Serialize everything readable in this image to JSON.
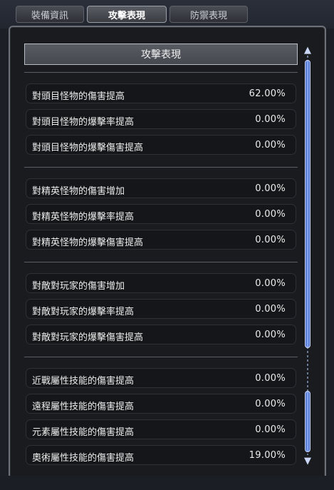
{
  "tabs": [
    {
      "label": "裝備資訊",
      "active": false
    },
    {
      "label": "攻擊表現",
      "active": true
    },
    {
      "label": "防禦表現",
      "active": false
    }
  ],
  "panel": {
    "header": "攻擊表現",
    "groups": [
      [
        {
          "label": "對頭目怪物的傷害提高",
          "value": "62.00%"
        },
        {
          "label": "對頭目怪物的爆擊率提高",
          "value": "0.00%"
        },
        {
          "label": "對頭目怪物的爆擊傷害提高",
          "value": "0.00%"
        }
      ],
      [
        {
          "label": "對精英怪物的傷害增加",
          "value": "0.00%"
        },
        {
          "label": "對精英怪物的爆擊率提高",
          "value": "0.00%"
        },
        {
          "label": "對精英怪物的爆擊傷害提高",
          "value": "0.00%"
        }
      ],
      [
        {
          "label": "對敵對玩家的傷害增加",
          "value": "0.00%"
        },
        {
          "label": "對敵對玩家的爆擊率提高",
          "value": "0.00%"
        },
        {
          "label": "對敵對玩家的爆擊傷害提高",
          "value": "0.00%"
        }
      ],
      [
        {
          "label": "近戰屬性技能的傷害提高",
          "value": "0.00%"
        },
        {
          "label": "遠程屬性技能的傷害提高",
          "value": "0.00%"
        },
        {
          "label": "元素屬性技能的傷害提高",
          "value": "0.00%"
        },
        {
          "label": "奧術屬性技能的傷害提高",
          "value": "19.00%"
        }
      ]
    ]
  },
  "scrollbar": {
    "up_icon": "scroll-up-arrow-icon",
    "down_icon": "scroll-down-arrow-icon"
  },
  "colors": {
    "accent": "#8fb0ff",
    "panel_bg": "#1a1b1f",
    "row_bg": "#151619",
    "text": "#ececec"
  }
}
